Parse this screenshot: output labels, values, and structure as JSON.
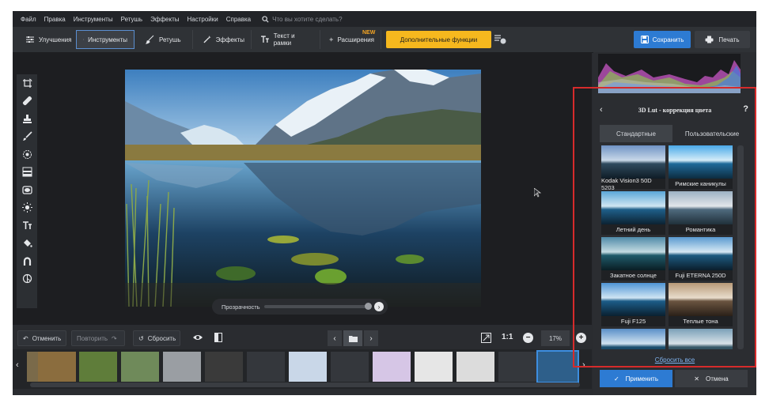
{
  "menu": {
    "items": [
      "Файл",
      "Правка",
      "Инструменты",
      "Ретушь",
      "Эффекты",
      "Настройки",
      "Справка"
    ],
    "search_placeholder": "Что вы хотите сделать?"
  },
  "toolbar": {
    "tabs": [
      "Улучшения",
      "Инструменты",
      "Ретушь",
      "Эффекты",
      "Текст и рамки",
      "Расширения"
    ],
    "new_badge": "NEW",
    "extra_label": "Дополнительные функции",
    "save_label": "Сохранить",
    "print_label": "Печать"
  },
  "tools": {
    "icons": [
      "crop-rotate-icon",
      "healing-icon",
      "stamp-icon",
      "brush-icon",
      "radial-icon",
      "gradient-icon",
      "vignette-icon",
      "light-icon",
      "text-icon",
      "fill-icon",
      "horseshoe-icon",
      "geo-icon"
    ]
  },
  "opacity": {
    "label": "Прозрачность",
    "value": 0.93
  },
  "bottom": {
    "undo_label": "Отменить",
    "redo_label": "Повторить",
    "reset_label": "Сбросить",
    "fit_label": "1:1",
    "zoom_value": "17%"
  },
  "lut": {
    "title": "3D Lut - коррекция цвета",
    "help": "?",
    "tabs": [
      "Стандартные",
      "Пользовательские"
    ],
    "presets": [
      "Kodak Vision3 50D 5203",
      "Римские каникулы",
      "Летний день",
      "Романтика",
      "Закатное солнце",
      "Fuji ETERNA 250D",
      "Fuji F125",
      "Теплые тона",
      "",
      ""
    ],
    "reset_all": "Сбросить все",
    "apply_label": "Применить",
    "cancel_label": "Отмена"
  },
  "colors": {
    "accent": "#2d7bd3",
    "highlight": "#f6b81e",
    "annotation": "#d62b2b"
  }
}
